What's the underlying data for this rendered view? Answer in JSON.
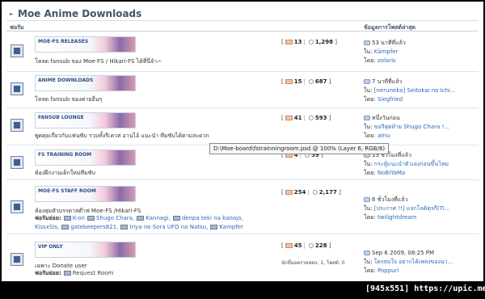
{
  "category": {
    "title": "Moe Anime Downloads"
  },
  "columns": {
    "forum": "ฟอรัม",
    "last_post": "ข้อมูลการโพสต์ล่าสุด"
  },
  "forums": [
    {
      "banner": "MOE-FS RELEASES",
      "description": "โหลด fansub ของ Moe-FS / Hikari-FS ได้ที่นี่จ้า~",
      "threads": "13",
      "posts": "1,298",
      "last_time": "53 นาทีที่แล้ว",
      "in_label": "ใน:",
      "last_thread": "Kämpfer",
      "by_label": "โดย:",
      "last_user": "zolaris"
    },
    {
      "banner": "ANIME DOWNLOADS",
      "description": "โหลด fansub ของค่ายอื่นๆ",
      "threads": "15",
      "posts": "687",
      "last_time": "7 นาทีที่แล้ว",
      "in_label": "ใน:",
      "last_thread": "[nerunekо] Seitokai no Ichi...",
      "by_label": "โดย:",
      "last_user": "Siegfried"
    },
    {
      "banner": "FANSUB LOUNGE",
      "description": "พูดคุยเกี่ยวกับแฟนซับ รวมทั้งรีเควส อานไอ้ แนะนำ ทีมซับได้ตามสะดวก",
      "threads": "41",
      "posts": "593",
      "last_time": "หนึ่งวันก่อน",
      "in_label": "ใน:",
      "last_thread": "ขอรีสุดท้าย Shugo Chara !...",
      "by_label": "โดย:",
      "last_user": "amu"
    },
    {
      "banner": "FS TRAINING ROOM",
      "description": "ห้องฝึกงานเด็กใหม่ทีมซับ",
      "threads": "4",
      "posts": "59",
      "last_time": "13 ชั่วโมงที่แล้ว",
      "in_label": "ใน:",
      "last_thread": "กระทู้แนะนำตัวเองก่อนขึ้นไหม่",
      "by_label": "โดย:",
      "last_user": "NoBiYaMa"
    },
    {
      "banner": "MOE-FS STAFF ROOM",
      "description": "ห้องสุมหัวบรรดาสต๊าฟ Moe-FS /Hikari-FS",
      "sub_label": "ฟอรัมย่อย:",
      "subforums": [
        "K-on",
        "Shugo Chara,",
        "Kannagi,",
        "denpa teki na kanojo,",
        "KissxSis,",
        "gatekeepers821,",
        "Iriya no Sora UFO no Natsu,",
        "Kampfer"
      ],
      "threads": "254",
      "posts": "2,177",
      "last_time": "6 ชั่วโมงที่แล้ว",
      "in_label": "ใน:",
      "last_thread": "[ประกาศ !!] แจกโลดิตุรกี(Ti...",
      "by_label": "โดย:",
      "last_user": "twilightdream"
    },
    {
      "banner": "VIP Only",
      "description": "เฉพาะ Donate user",
      "sub_label": "ฟอรัมย่อย:",
      "subforums": [
        "Request Room"
      ],
      "threads": "45",
      "posts": "228",
      "mod_note": "นักขี่มอตรวจสอบ: 1, โพสต์: 0",
      "last_time": "Sep 6 2009, 08:25 PM",
      "in_label": "ใน:",
      "last_thread": "ใครสมใจ อยากได้เพลงของนา...",
      "by_label": "โดย:",
      "last_user": "Poppuri"
    }
  ],
  "tooltip": "D:\\Moe-board\\fstrainningroom.psd @ 100% (Layer 6, RGB/8)",
  "watermark": "[945x551] https://upic.me/"
}
